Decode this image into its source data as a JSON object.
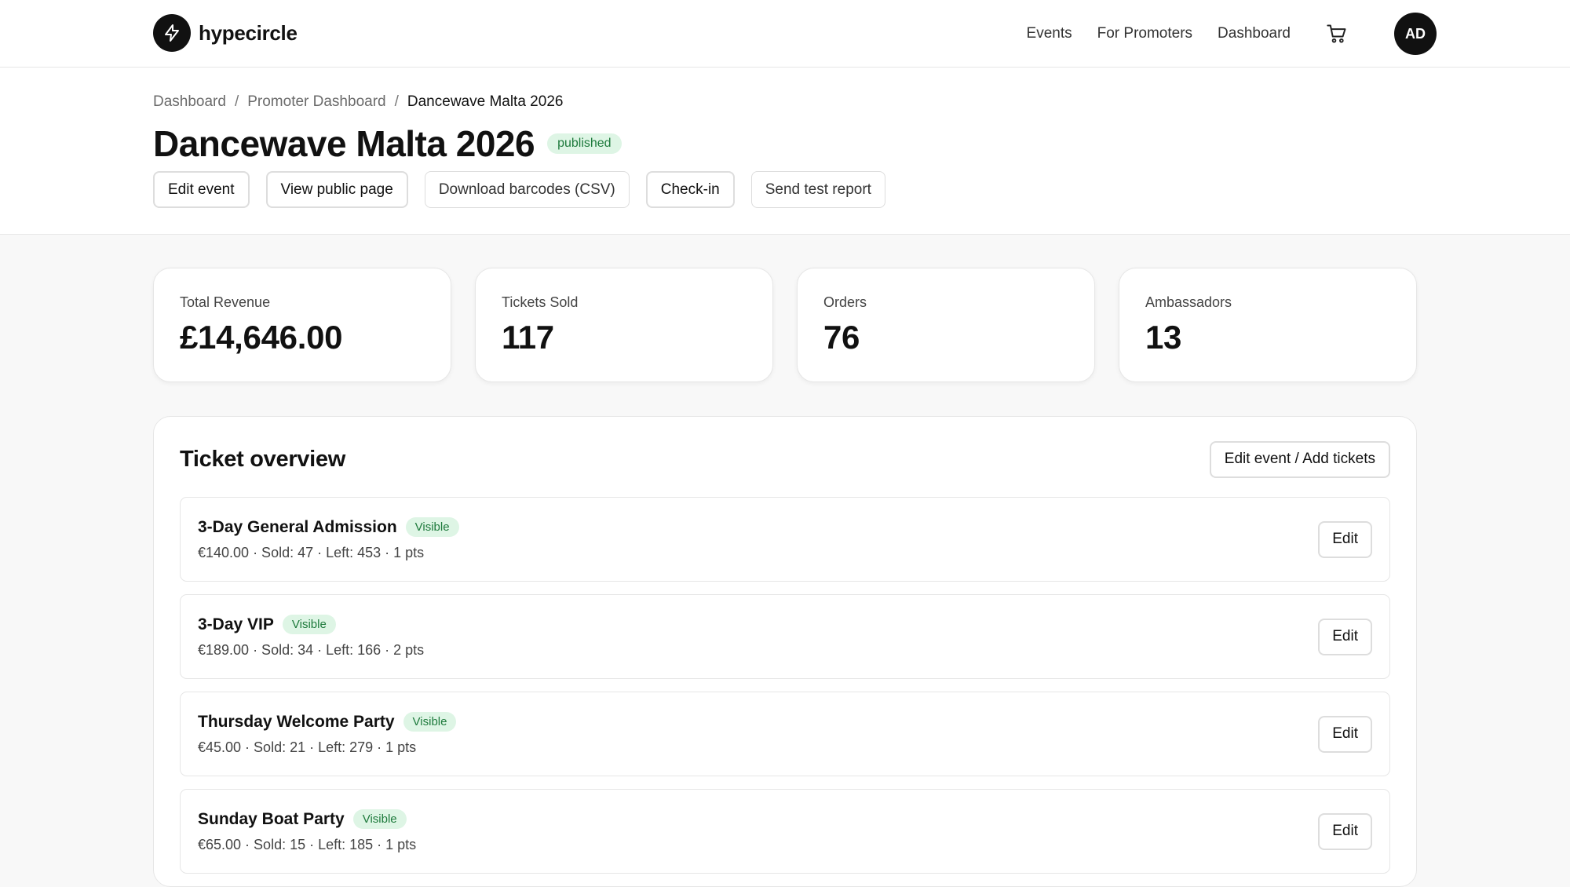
{
  "brand": {
    "name": "hypecircle"
  },
  "nav": {
    "links": [
      "Events",
      "For Promoters",
      "Dashboard"
    ],
    "cart_icon": "cart-icon",
    "avatar_initials": "AD"
  },
  "breadcrumb": {
    "items": [
      "Dashboard",
      "Promoter Dashboard",
      "Dancewave Malta 2026"
    ],
    "separator": "/"
  },
  "event": {
    "title": "Dancewave Malta 2026",
    "status": "published",
    "actions": [
      "Edit event",
      "View public page",
      "Download barcodes (CSV)",
      "Check-in",
      "Send test report"
    ]
  },
  "stats": [
    {
      "label": "Total Revenue",
      "value": "£14,646.00"
    },
    {
      "label": "Tickets Sold",
      "value": "117"
    },
    {
      "label": "Orders",
      "value": "76"
    },
    {
      "label": "Ambassadors",
      "value": "13"
    }
  ],
  "ticket_overview": {
    "title": "Ticket overview",
    "edit_add_label": "Edit event / Add tickets",
    "edit_label": "Edit",
    "tickets": [
      {
        "name": "3-Day General Admission",
        "status": "Visible",
        "meta": "€140.00 · Sold: 47 · Left: 453 · 1 pts"
      },
      {
        "name": "3-Day VIP",
        "status": "Visible",
        "meta": "€189.00 · Sold: 34 · Left: 166 · 2 pts"
      },
      {
        "name": "Thursday Welcome Party",
        "status": "Visible",
        "meta": "€45.00 · Sold: 21 · Left: 279 · 1 pts"
      },
      {
        "name": "Sunday Boat Party",
        "status": "Visible",
        "meta": "€65.00 · Sold: 15 · Left: 185 · 1 pts"
      }
    ]
  },
  "colors": {
    "accent_dark": "#111111",
    "status_bg": "#def5e5",
    "status_text": "#1e7a3c"
  }
}
